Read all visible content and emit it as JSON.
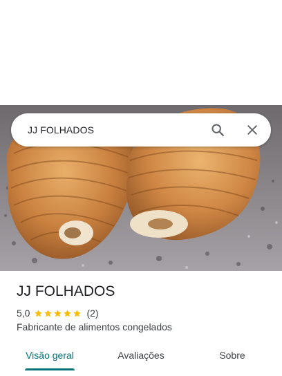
{
  "search": {
    "query": "JJ FOLHADOS"
  },
  "icons": {
    "search": "search-icon",
    "close": "close-icon",
    "star": "star-icon"
  },
  "place": {
    "name": "JJ FOLHADOS",
    "rating": "5,0",
    "stars": 5,
    "reviews": "(2)",
    "category": "Fabricante de alimentos congelados"
  },
  "tabs": [
    {
      "label": "Visão geral",
      "active": true
    },
    {
      "label": "Avaliações",
      "active": false
    },
    {
      "label": "Sobre",
      "active": false
    }
  ],
  "colors": {
    "accent": "#00737a",
    "star": "#fbbc04",
    "text": "#202124",
    "secondary_text": "#3c4043"
  }
}
